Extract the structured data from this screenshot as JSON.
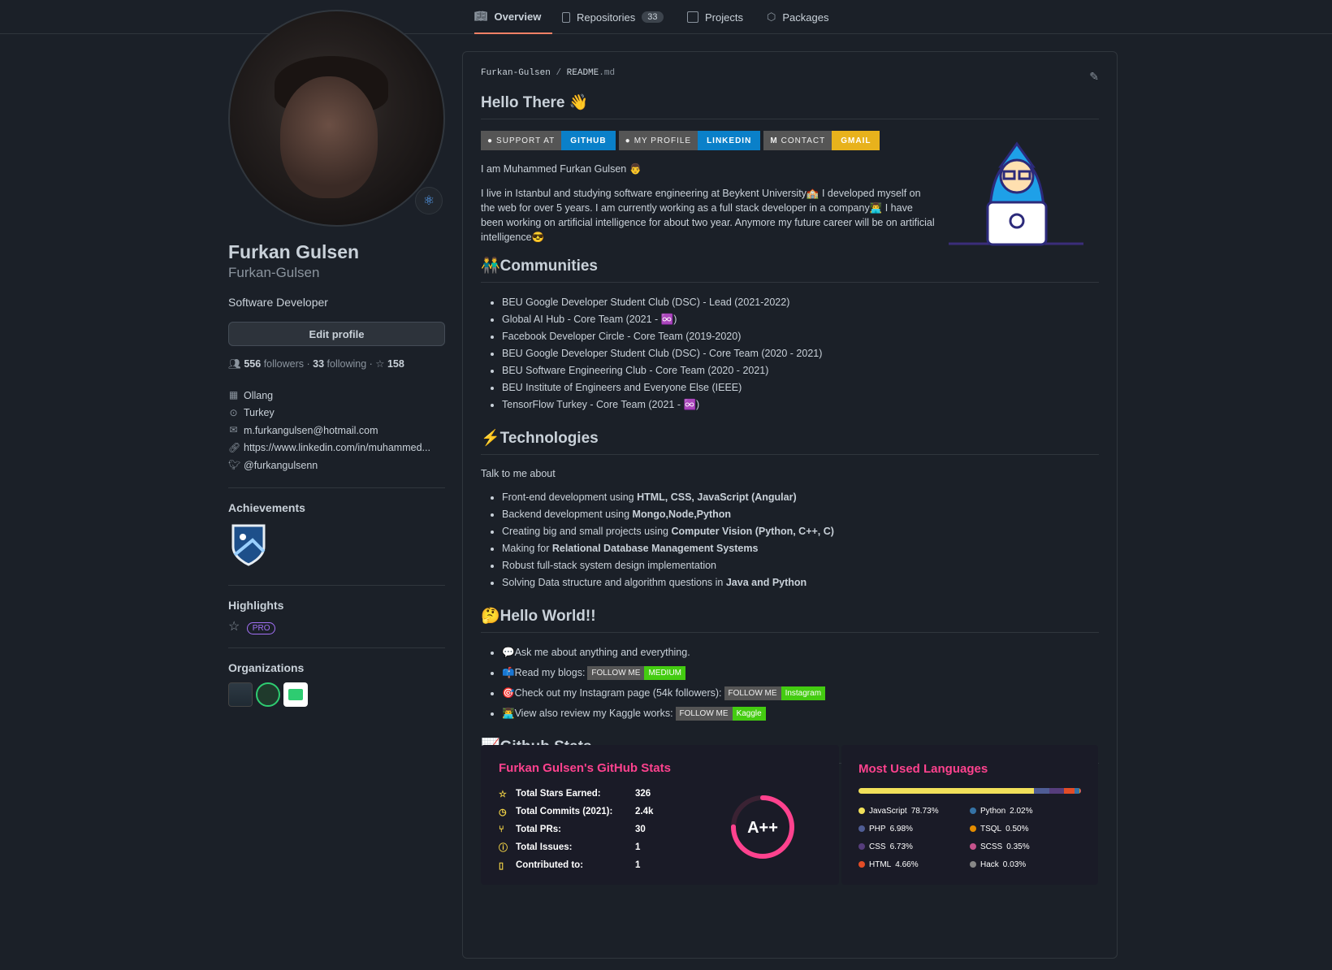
{
  "tabs": [
    {
      "label": "Overview",
      "icon": "book-icon"
    },
    {
      "label": "Repositories",
      "count": "33",
      "icon": "repo-icon"
    },
    {
      "label": "Projects",
      "icon": "table-icon"
    },
    {
      "label": "Packages",
      "icon": "package-icon"
    }
  ],
  "profile": {
    "name": "Furkan Gulsen",
    "login": "Furkan-Gulsen",
    "bio": "Software Developer",
    "edit_label": "Edit profile",
    "followers": "556",
    "followers_label": "followers",
    "following": "33",
    "following_label": "following",
    "stars": "158",
    "company": "Ollang",
    "location": "Turkey",
    "email": "m.furkangulsen@hotmail.com",
    "website": "https://www.linkedin.com/in/muhammed...",
    "twitter": "@furkangulsenn"
  },
  "sections": {
    "achievements": "Achievements",
    "highlights": "Highlights",
    "pro": "PRO",
    "organizations": "Organizations"
  },
  "readme": {
    "path_user": "Furkan-Gulsen",
    "path_sep": "/",
    "path_file": "README",
    "path_ext": ".md",
    "title": "Hello There 👋",
    "shields": [
      {
        "left": "SUPPORT AT",
        "right": "GITHUB",
        "color": "#0a80c9"
      },
      {
        "left": "MY PROFILE",
        "right": "LINKEDIN",
        "color": "#0a80c9"
      },
      {
        "left": "CONTACT",
        "right": "GMAIL",
        "color": "#e8b21c"
      }
    ],
    "intro": "I am Muhammed Furkan Gulsen 👨",
    "about": "I live in Istanbul and studying software engineering at Beykent University🏫 I developed myself on the web for over 5 years. I am currently working as a full stack developer in a company👨‍💻 I have been working on artificial intelligence for about two year. Anymore my future career will be on artificial intelligence😎",
    "communities_title": "👬Communities",
    "communities": [
      "BEU Google Developer Student Club (DSC) - Lead (2021-2022)",
      "Global AI Hub - Core Team (2021 - ♾️)",
      "Facebook Developer Circle - Core Team (2019-2020)",
      "BEU Google Developer Student Club (DSC) - Core Team (2020 - 2021)",
      "BEU Software Engineering Club - Core Team (2020 - 2021)",
      "BEU Institute of Engineers and Everyone Else (IEEE)",
      "TensorFlow Turkey - Core Team (2021 - ♾️)"
    ],
    "tech_title": "⚡Technologies",
    "tech_intro": "Talk to me about",
    "tech": [
      {
        "pre": "Front-end development using ",
        "bold": "HTML, CSS, JavaScript (Angular)"
      },
      {
        "pre": "Backend development using ",
        "bold": "Mongo,Node,Python"
      },
      {
        "pre": "Creating big and small projects using ",
        "bold": "Computer Vision (Python, C++, C)"
      },
      {
        "pre": "Making for ",
        "bold": "Relational Database Management Systems"
      },
      {
        "pre": "Robust full-stack system design implementation",
        "bold": ""
      },
      {
        "pre": "Solving Data structure and algorithm questions in ",
        "bold": "Java and Python"
      }
    ],
    "hello_title": "🤔Hello World!!",
    "hello": [
      {
        "text": "💬Ask me about anything and everything.",
        "badge_l": "",
        "badge_r": ""
      },
      {
        "text": "📫Read my blogs:",
        "badge_l": "FOLLOW ME",
        "badge_r": "MEDIUM"
      },
      {
        "text": "🎯Check out my Instagram page (54k followers):",
        "badge_l": "FOLLOW ME",
        "badge_r": "Instagram"
      },
      {
        "text": "👨‍💻View also review my Kaggle works:",
        "badge_l": "FOLLOW ME",
        "badge_r": "Kaggle"
      }
    ],
    "stats_title": "📈Github Stats"
  },
  "stats_card": {
    "title": "Furkan Gulsen's GitHub Stats",
    "rows": [
      {
        "label": "Total Stars Earned:",
        "value": "326",
        "icon": "star-icon"
      },
      {
        "label": "Total Commits (2021):",
        "value": "2.4k",
        "icon": "history-icon"
      },
      {
        "label": "Total PRs:",
        "value": "30",
        "icon": "pr-icon"
      },
      {
        "label": "Total Issues:",
        "value": "1",
        "icon": "issue-icon"
      },
      {
        "label": "Contributed to:",
        "value": "1",
        "icon": "repo-icon"
      }
    ],
    "grade": "A++",
    "grade_progress": 0.75
  },
  "langs_card": {
    "title": "Most Used Languages",
    "langs": [
      {
        "name": "JavaScript",
        "pct": "78.73%",
        "value": 78.73,
        "color": "#f1e05a"
      },
      {
        "name": "Python",
        "pct": "2.02%",
        "value": 2.02,
        "color": "#3572A5"
      },
      {
        "name": "PHP",
        "pct": "6.98%",
        "value": 6.98,
        "color": "#4F5D95"
      },
      {
        "name": "TSQL",
        "pct": "0.50%",
        "value": 0.5,
        "color": "#e38c00"
      },
      {
        "name": "CSS",
        "pct": "6.73%",
        "value": 6.73,
        "color": "#563d7c"
      },
      {
        "name": "SCSS",
        "pct": "0.35%",
        "value": 0.35,
        "color": "#c6538c"
      },
      {
        "name": "HTML",
        "pct": "4.66%",
        "value": 4.66,
        "color": "#e34c26"
      },
      {
        "name": "Hack",
        "pct": "0.03%",
        "value": 0.03,
        "color": "#878787"
      }
    ]
  }
}
